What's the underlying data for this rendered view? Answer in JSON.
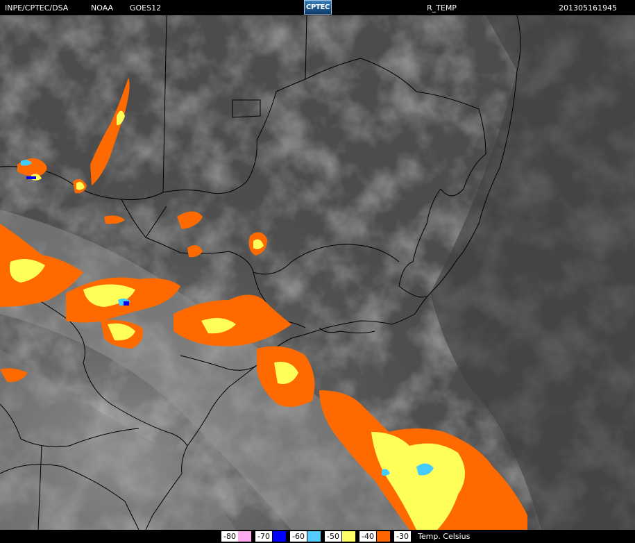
{
  "header": {
    "source": "INPE/CPTEC/DSA",
    "agency": "NOAA",
    "satellite": "GOES12",
    "logo_text": "CPTEC",
    "product": "R_TEMP",
    "timestamp": "201305161945"
  },
  "legend": {
    "title": "Temp. Celsius",
    "items": [
      {
        "label": "-80",
        "color": "#ffaaee"
      },
      {
        "label": "-70",
        "color": "#0000ff"
      },
      {
        "label": "-60",
        "color": "#55ccff"
      },
      {
        "label": "-50",
        "color": "#ffff66"
      },
      {
        "label": "-40",
        "color": "#ff6600"
      },
      {
        "label": "-30",
        "color": "#ffffff"
      }
    ]
  },
  "colors": {
    "cloud_-30": "#ff6a00",
    "cloud_-40": "#ffff5a",
    "cloud_-50": "#44ccff",
    "cloud_-60": "#0000ee",
    "background": "#000000",
    "borders": "#000000"
  }
}
